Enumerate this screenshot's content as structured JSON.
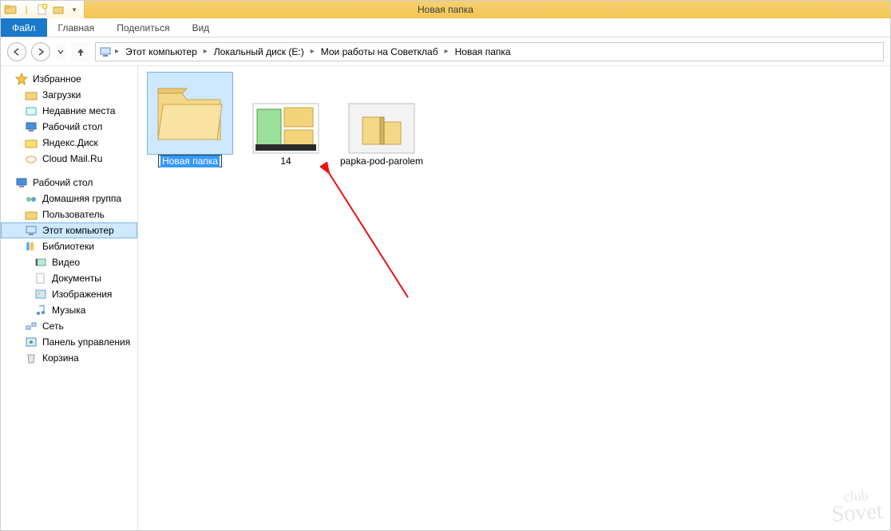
{
  "window_title": "Новая папка",
  "ribbon": {
    "file": "Файл",
    "tabs": [
      "Главная",
      "Поделиться",
      "Вид"
    ]
  },
  "breadcrumb": [
    "Этот компьютер",
    "Локальный диск (E:)",
    "Мои работы на Советклаб",
    "Новая папка"
  ],
  "sidebar": {
    "favorites": {
      "header": "Избранное",
      "items": [
        "Загрузки",
        "Недавние места",
        "Рабочий стол",
        "Яндекс.Диск",
        "Cloud Mail.Ru"
      ]
    },
    "desktop": {
      "header": "Рабочий стол",
      "items": [
        "Домашняя группа",
        "Пользователь",
        "Этот компьютер",
        "Библиотеки",
        "Видео",
        "Документы",
        "Изображения",
        "Музыка",
        "Сеть",
        "Панель управления",
        "Корзина"
      ]
    }
  },
  "content": {
    "items": [
      {
        "name": "Новая папка",
        "type": "folder",
        "selected_rename": true
      },
      {
        "name": "14",
        "type": "thumb-folders"
      },
      {
        "name": "papka-pod-parolem",
        "type": "thumb-zip"
      }
    ]
  },
  "watermark": {
    "l1": "club",
    "l2": "Sovet"
  }
}
